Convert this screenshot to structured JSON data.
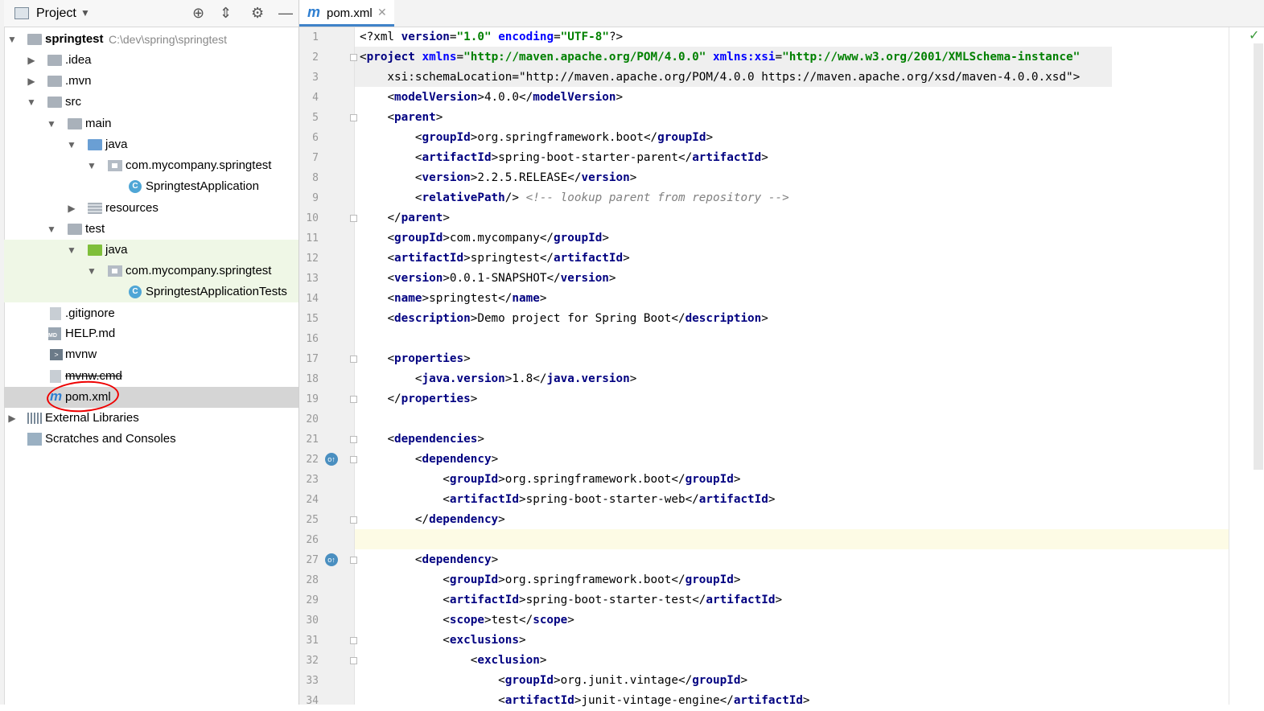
{
  "project_panel": {
    "title": "Project",
    "toolbar": [
      "locate-icon",
      "collapse-icon",
      "gear-icon",
      "minimize-icon"
    ],
    "tree": [
      {
        "label": "springtest",
        "path": "C:\\dev\\spring\\springtest"
      },
      {
        "label": ".idea"
      },
      {
        "label": ".mvn"
      },
      {
        "label": "src"
      },
      {
        "label": "main"
      },
      {
        "label": "java"
      },
      {
        "label": "com.mycompany.springtest"
      },
      {
        "label": "SpringtestApplication"
      },
      {
        "label": "resources"
      },
      {
        "label": "test"
      },
      {
        "label": "java"
      },
      {
        "label": "com.mycompany.springtest"
      },
      {
        "label": "SpringtestApplicationTests"
      },
      {
        "label": ".gitignore"
      },
      {
        "label": "HELP.md"
      },
      {
        "label": "mvnw"
      },
      {
        "label": "mvnw.cmd"
      },
      {
        "label": "pom.xml"
      },
      {
        "label": "External Libraries"
      },
      {
        "label": "Scratches and Consoles"
      }
    ]
  },
  "editor": {
    "tab_label": "pom.xml",
    "tab_icon": "m",
    "lines": [
      "<?xml version=\"1.0\" encoding=\"UTF-8\"?>",
      "<project xmlns=\"http://maven.apache.org/POM/4.0.0\" xmlns:xsi=\"http://www.w3.org/2001/XMLSchema-instance\"",
      "    xsi:schemaLocation=\"http://maven.apache.org/POM/4.0.0 https://maven.apache.org/xsd/maven-4.0.0.xsd\">",
      "    <modelVersion>4.0.0</modelVersion>",
      "    <parent>",
      "        <groupId>org.springframework.boot</groupId>",
      "        <artifactId>spring-boot-starter-parent</artifactId>",
      "        <version>2.2.5.RELEASE</version>",
      "        <relativePath/> <!-- lookup parent from repository -->",
      "    </parent>",
      "    <groupId>com.mycompany</groupId>",
      "    <artifactId>springtest</artifactId>",
      "    <version>0.0.1-SNAPSHOT</version>",
      "    <name>springtest</name>",
      "    <description>Demo project for Spring Boot</description>",
      "",
      "    <properties>",
      "        <java.version>1.8</java.version>",
      "    </properties>",
      "",
      "    <dependencies>",
      "        <dependency>",
      "            <groupId>org.springframework.boot</groupId>",
      "            <artifactId>spring-boot-starter-web</artifactId>",
      "        </dependency>",
      "",
      "        <dependency>",
      "            <groupId>org.springframework.boot</groupId>",
      "            <artifactId>spring-boot-starter-test</artifactId>",
      "            <scope>test</scope>",
      "            <exclusions>",
      "                <exclusion>",
      "                    <groupId>org.junit.vintage</groupId>",
      "                    <artifactId>junit-vintage-engine</artifactId>"
    ]
  }
}
